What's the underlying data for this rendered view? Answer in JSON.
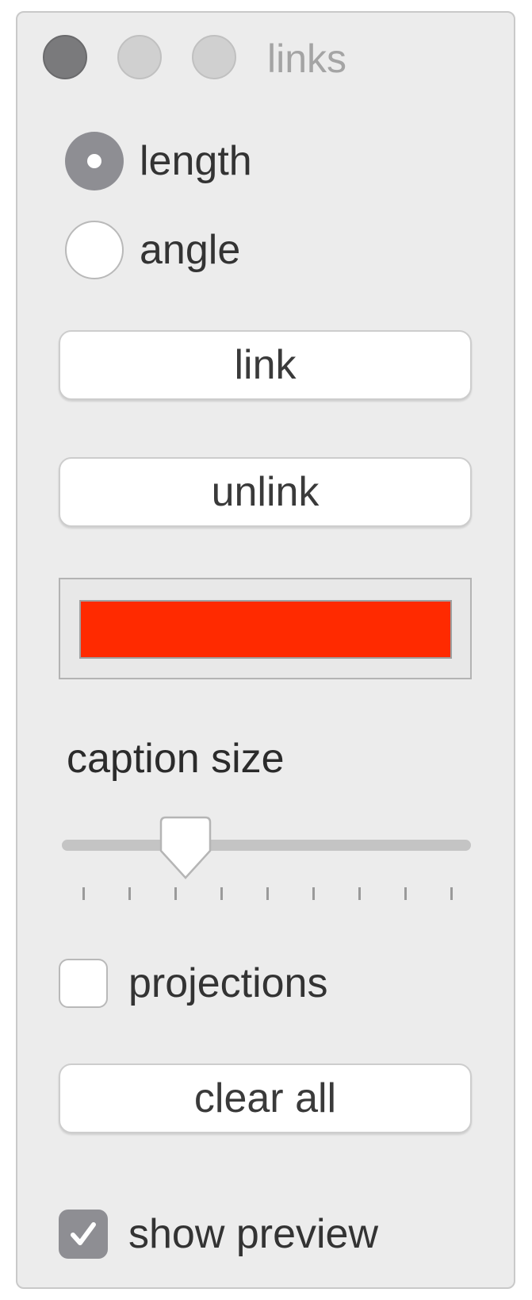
{
  "window": {
    "title": "links"
  },
  "mode": {
    "options": [
      {
        "label": "length",
        "selected": true
      },
      {
        "label": "angle",
        "selected": false
      }
    ]
  },
  "buttons": {
    "link": "link",
    "unlink": "unlink",
    "clear_all": "clear all"
  },
  "color_well": {
    "color": "#ff2a00"
  },
  "caption_size": {
    "label": "caption size",
    "tick_count": 9,
    "value_fraction": 0.28
  },
  "projections": {
    "label": "projections",
    "checked": false
  },
  "show_preview": {
    "label": "show preview",
    "checked": true
  }
}
